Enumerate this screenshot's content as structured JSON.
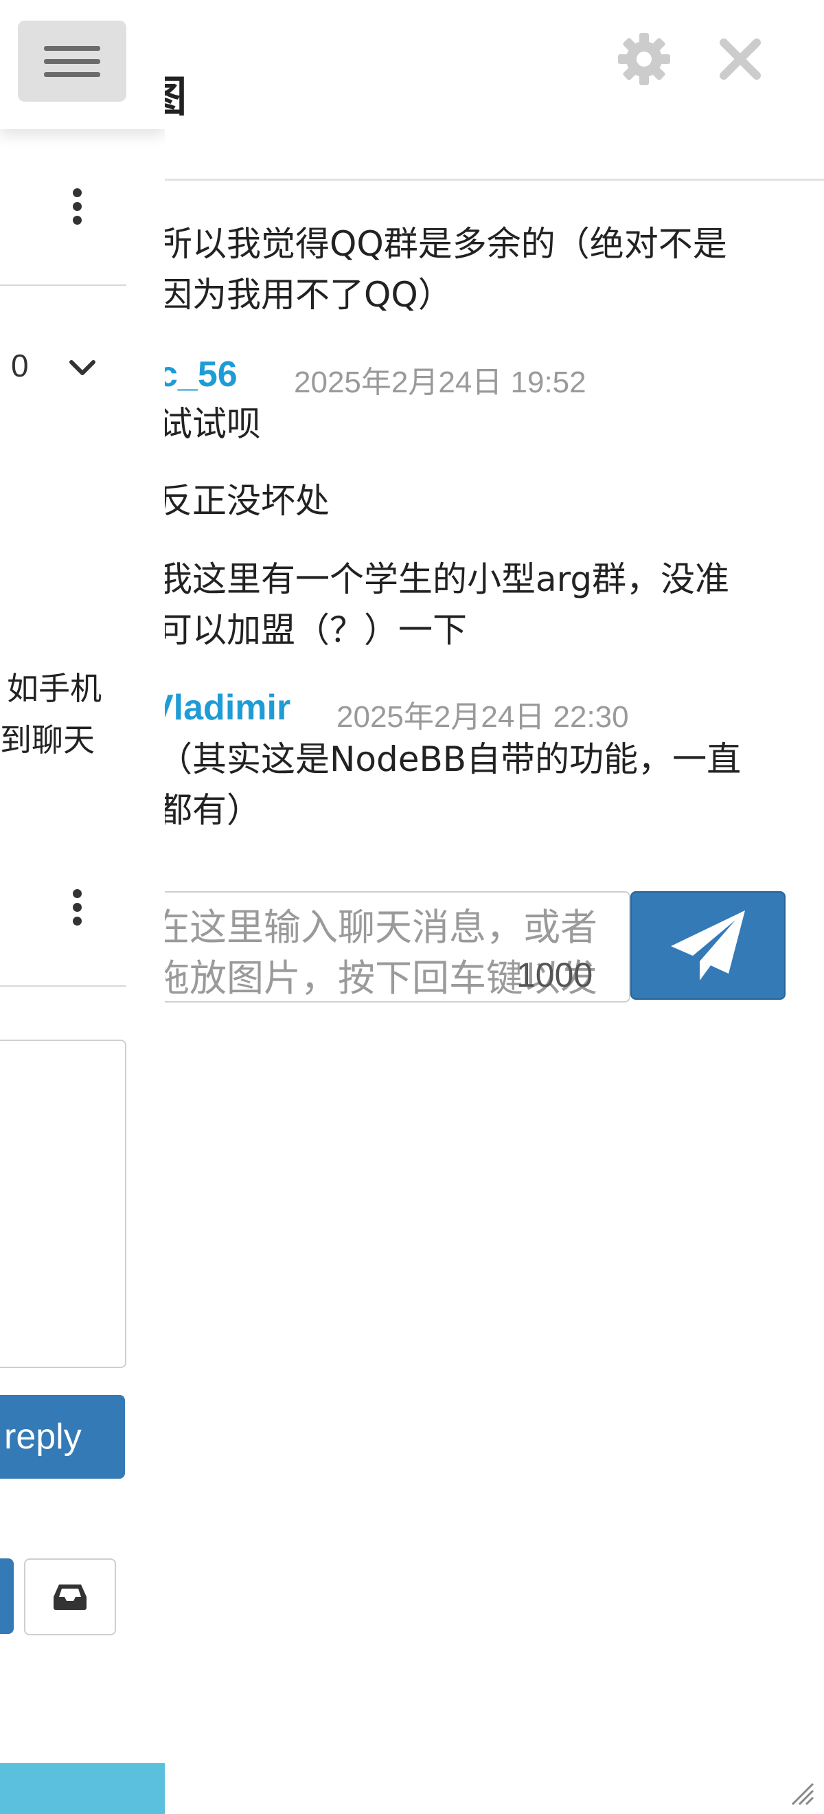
{
  "background_page": {
    "count_value": "0",
    "snippet_lines": [
      "如手机",
      "到聊天"
    ],
    "reply_label": "reply",
    "accent_color": "#337ab7",
    "bottom_bar_color": "#5bc0de"
  },
  "chat": {
    "title_fragment": "图",
    "messages": [
      {
        "lines": [
          "所以我觉得QQ群是多余的（绝对不是",
          "因为我用不了QQ）"
        ]
      },
      {
        "author": "c_56",
        "timestamp": "2025年2月24日 19:52",
        "lines": [
          "试试呗"
        ]
      },
      {
        "lines": [
          "反正没坏处"
        ]
      },
      {
        "lines": [
          "我这里有一个学生的小型arg群，没准",
          "可以加盟（？）一下"
        ]
      },
      {
        "author": "Vladimir",
        "timestamp": "2025年2月24日 22:30",
        "lines": [
          "（其实这是NodeBB自带的功能，一直",
          "都有）"
        ]
      }
    ],
    "composer": {
      "placeholder": "在这里输入聊天消息，或者拖放图片，按下回车键以发送",
      "char_count": "1000"
    },
    "author_color": "#1e9cd6",
    "icons": {
      "settings": "gear-icon",
      "close": "close-icon",
      "send": "paper-plane-icon"
    }
  }
}
